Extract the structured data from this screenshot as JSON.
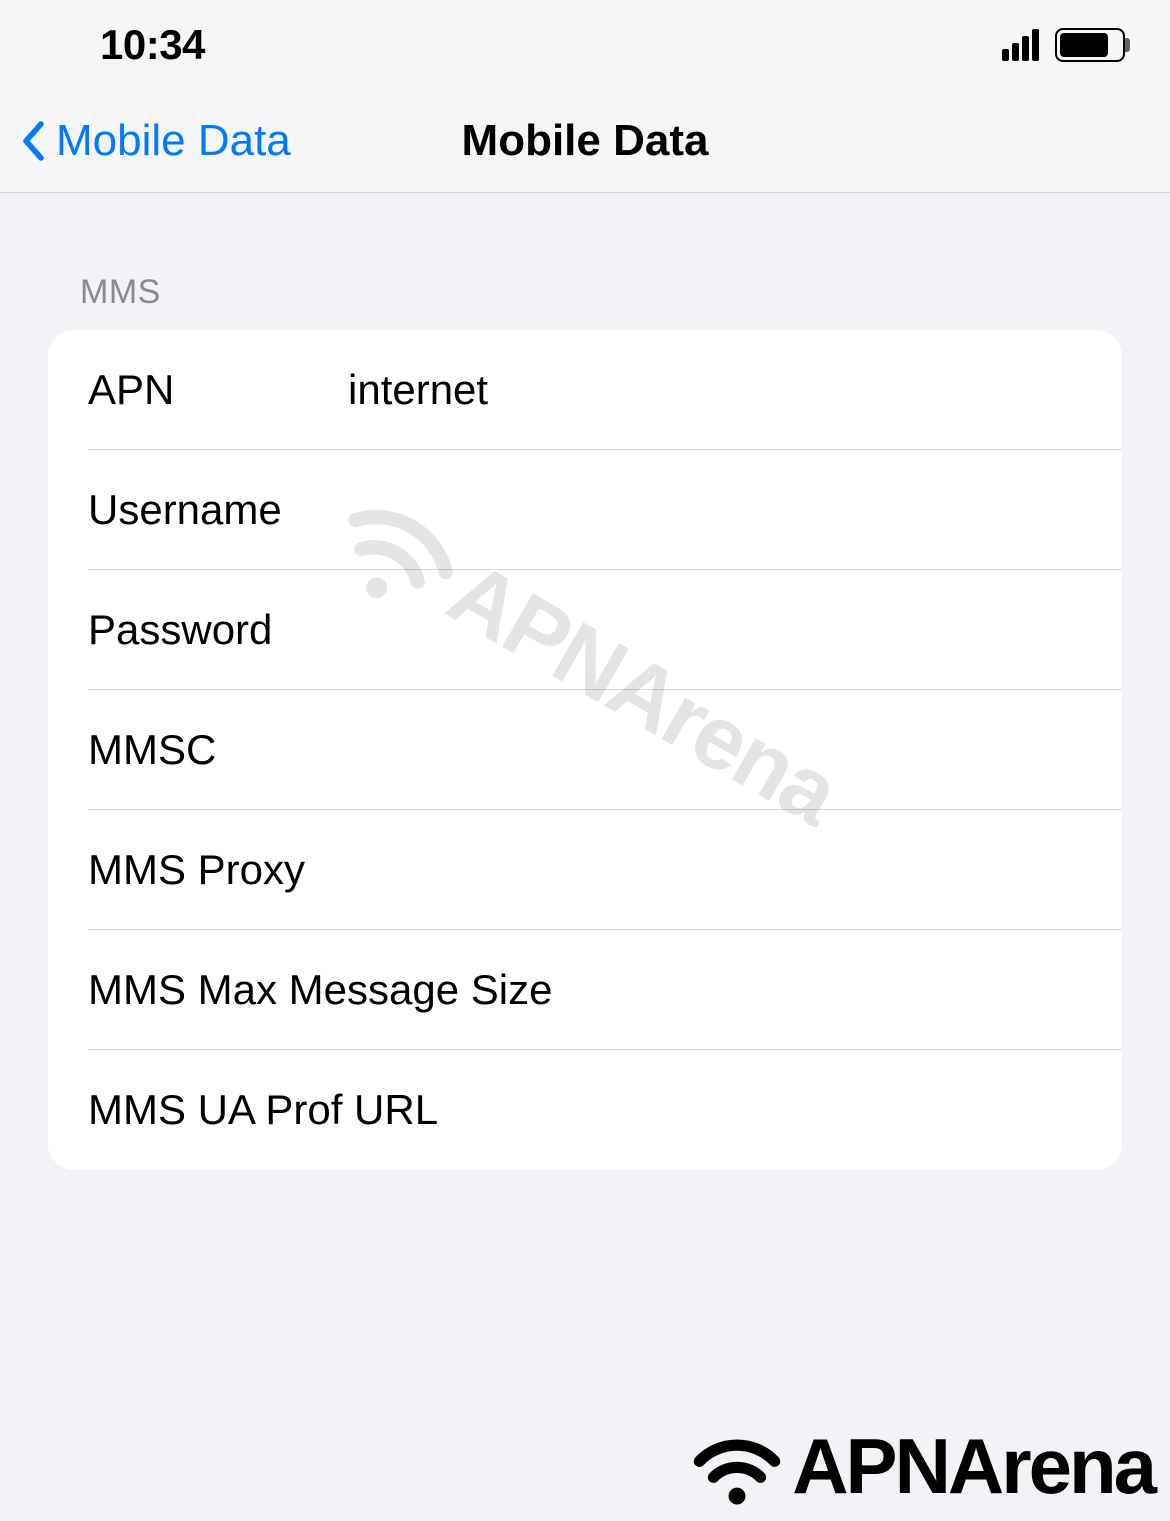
{
  "status": {
    "time": "10:34"
  },
  "nav": {
    "back_label": "Mobile Data",
    "title": "Mobile Data"
  },
  "section": {
    "header": "MMS",
    "rows": [
      {
        "label": "APN",
        "value": "internet",
        "wide": false
      },
      {
        "label": "Username",
        "value": "",
        "wide": false
      },
      {
        "label": "Password",
        "value": "",
        "wide": false
      },
      {
        "label": "MMSC",
        "value": "",
        "wide": false
      },
      {
        "label": "MMS Proxy",
        "value": "",
        "wide": false
      },
      {
        "label": "MMS Max Message Size",
        "value": "",
        "wide": true
      },
      {
        "label": "MMS UA Prof URL",
        "value": "",
        "wide": true
      }
    ]
  },
  "watermark": {
    "text": "APNArena"
  }
}
